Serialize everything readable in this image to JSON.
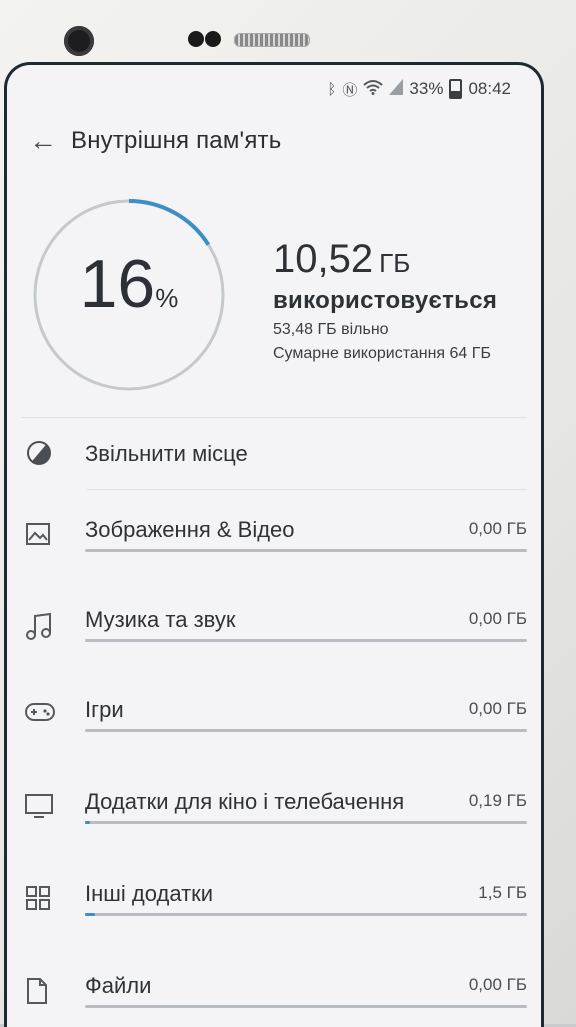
{
  "status": {
    "battery": "33%",
    "time": "08:42"
  },
  "header": {
    "title": "Внутрішня пам'ять"
  },
  "usage": {
    "percent": "16",
    "percent_sign": "%",
    "used_value": "10,52",
    "used_unit": "ГБ",
    "used_label": "використовується",
    "free": "53,48 ГБ вільно",
    "total": "Сумарне використання 64 ГБ"
  },
  "colors": {
    "ring_track": "#c5c8cc",
    "ring_fill": "#3c8ec4",
    "screen_bg": "#f4f4f6"
  },
  "free_space": {
    "label": "Звільнити місце",
    "icon": "pie-icon"
  },
  "categories": [
    {
      "label": "Зображення & Відео",
      "size": "0,00 ГБ",
      "icon": "image-icon",
      "fill": 0
    },
    {
      "label": "Музика та звук",
      "size": "0,00 ГБ",
      "icon": "music-icon",
      "fill": 0
    },
    {
      "label": "Ігри",
      "size": "0,00 ГБ",
      "icon": "gamepad-icon",
      "fill": 0
    },
    {
      "label": "Додатки для кіно і телебачення",
      "size": "0,19 ГБ",
      "icon": "tv-icon",
      "fill": 0.003
    },
    {
      "label": "Інші додатки",
      "size": "1,5 ГБ",
      "icon": "apps-grid-icon",
      "fill": 0.023
    },
    {
      "label": "Файли",
      "size": "0,00 ГБ",
      "icon": "file-icon",
      "fill": 0
    }
  ]
}
